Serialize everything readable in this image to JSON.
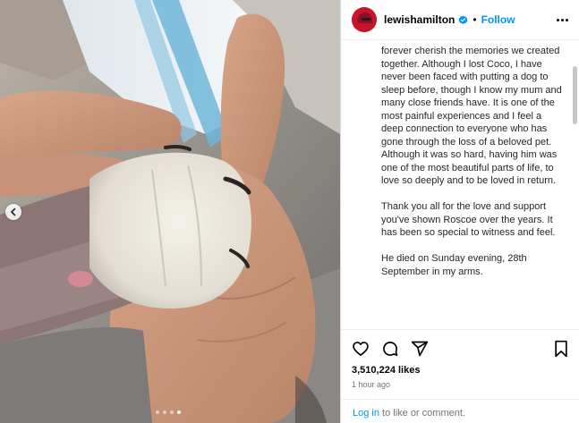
{
  "post": {
    "username": "lewishamilton",
    "follow_label": "Follow",
    "separator": "•",
    "caption_paragraphs": [
      "forever cherish the memories we created together. Although I lost Coco, I have never been faced with putting a dog to sleep before, though I know my mum and many close friends have. It is one of the most painful experiences and I feel a deep connection to everyone who has gone through the loss of a beloved pet. Although it was so hard, having him was one of the most beautiful parts of life, to love so deeply and to be loved in return.",
      "Thank you all for the love and support you've shown Roscoe over the years. It has been so special to witness and feel.",
      "He died on Sunday evening, 28th September in my arms."
    ],
    "likes": "3,510,224 likes",
    "time_ago": "1 hour ago"
  },
  "carousel": {
    "slides": 4,
    "active_index": 3
  },
  "footer": {
    "login_label": "Log in",
    "suffix": " to like or comment."
  },
  "icons": {
    "verified": "verified-badge-icon",
    "more": "more-options-icon",
    "like": "heart-icon",
    "comment": "comment-icon",
    "share": "share-icon",
    "save": "bookmark-icon",
    "prev": "chevron-left-icon"
  },
  "colors": {
    "accent": "#0095f6",
    "avatar": "#c8142a",
    "muted": "#737373"
  }
}
